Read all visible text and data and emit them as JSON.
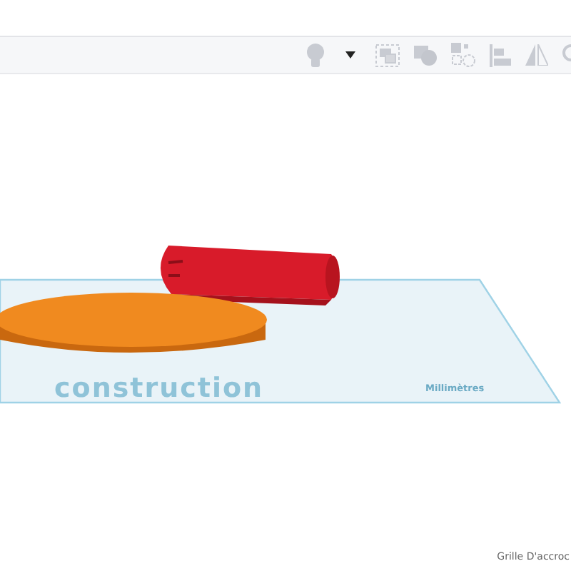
{
  "workplane": {
    "label": "construction",
    "units": "Millimètres"
  },
  "status": {
    "snap_grid": "Grille D'accroc"
  }
}
